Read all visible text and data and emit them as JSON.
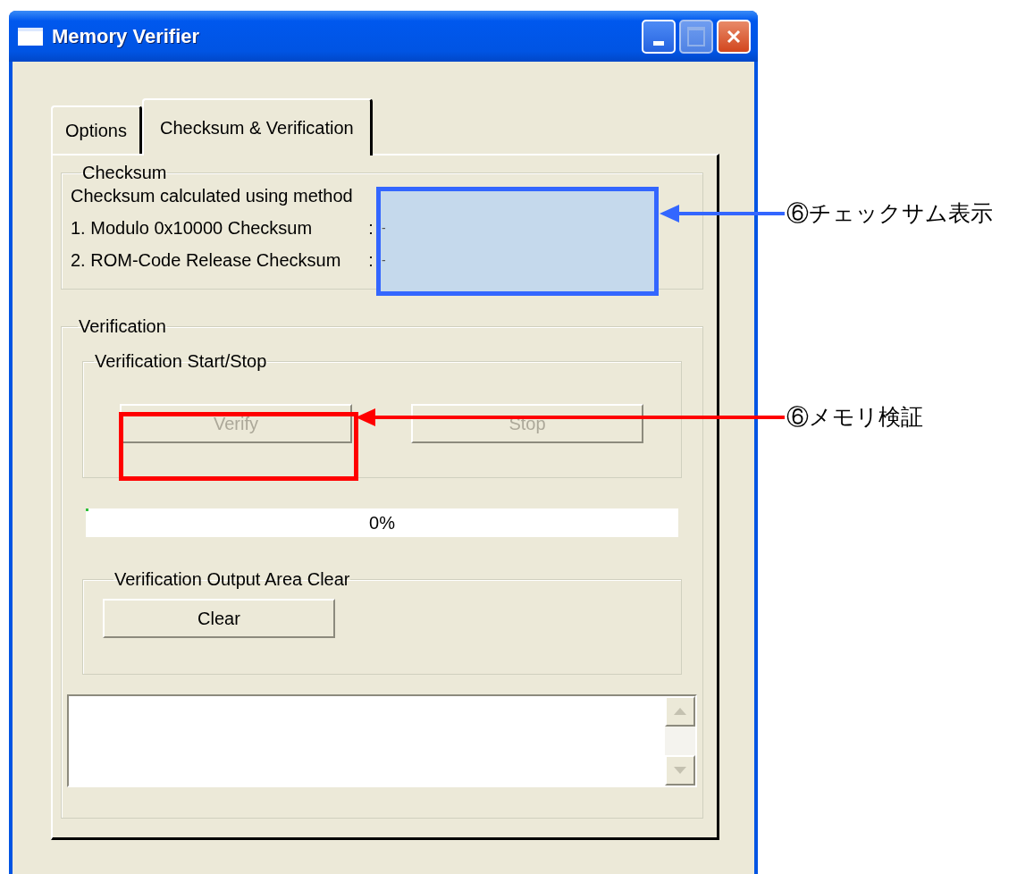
{
  "window": {
    "title": "Memory Verifier"
  },
  "tabs": [
    {
      "label": "Options",
      "selected": false
    },
    {
      "label": "Checksum & Verification",
      "selected": true
    }
  ],
  "checksum": {
    "legend": "Checksum",
    "rows": [
      {
        "label": "Checksum calculated using method"
      },
      {
        "label": "1. Modulo 0x10000 Checksum",
        "colon": ":",
        "value": "-"
      },
      {
        "label": "2. ROM-Code Release Checksum",
        "colon": ":",
        "value": "-"
      }
    ]
  },
  "verification": {
    "legend": "Verification",
    "start_stop": {
      "legend": "Verification Start/Stop",
      "buttons": [
        {
          "label": "Verify",
          "disabled": true
        },
        {
          "label": "Stop",
          "disabled": true
        }
      ]
    },
    "progress": {
      "level": 0,
      "reading": "0%"
    },
    "clear_group": {
      "legend": "Verification Output Area Clear",
      "button": {
        "label": "Clear",
        "disabled": false
      }
    }
  },
  "annotations": [
    {
      "label": "⑥チェックサム表示",
      "color": "#3366ff"
    },
    {
      "label": "⑥メモリ検証",
      "color": "#ff0000"
    }
  ]
}
